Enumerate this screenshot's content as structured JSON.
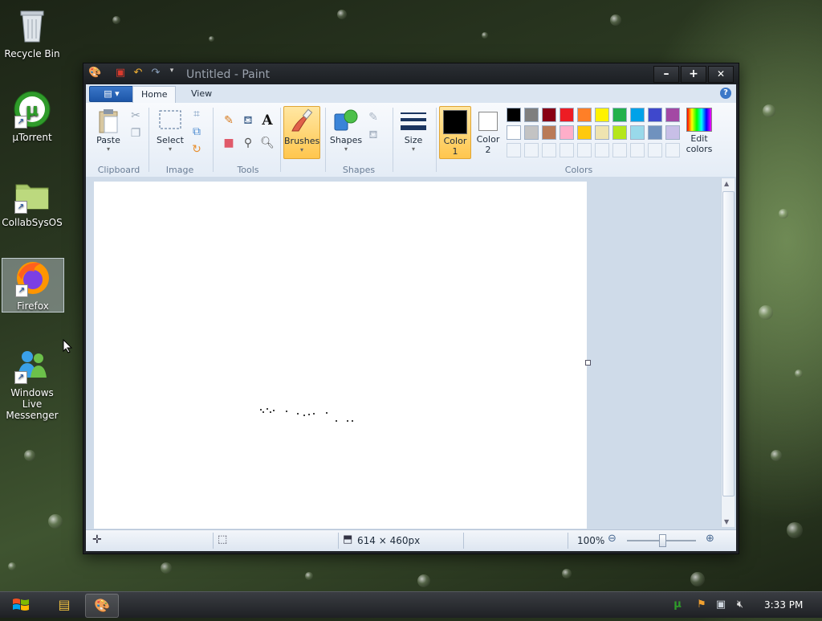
{
  "desktop": {
    "icons": [
      {
        "label": "Recycle Bin"
      },
      {
        "label": "µTorrent"
      },
      {
        "label": "CollabSysOS"
      },
      {
        "label": "Firefox"
      },
      {
        "label": "Windows Live Messenger"
      }
    ]
  },
  "window": {
    "title": "Untitled - Paint",
    "buttons": {
      "minimize": "–",
      "maximize": "+",
      "close": "✕"
    }
  },
  "tabs": {
    "home": "Home",
    "view": "View",
    "help": "?"
  },
  "ribbon": {
    "clipboard": {
      "paste": "Paste",
      "label": "Clipboard"
    },
    "image": {
      "select": "Select",
      "label": "Image"
    },
    "tools": {
      "label": "Tools"
    },
    "brushes": {
      "label": "Brushes"
    },
    "shapes": {
      "shapes": "Shapes",
      "label": "Shapes"
    },
    "size": {
      "label": "Size"
    },
    "colors": {
      "color1": "Color",
      "color1_num": "1",
      "color2": "Color",
      "color2_num": "2",
      "edit": "Edit",
      "edit2": "colors",
      "label": "Colors",
      "palette_row1": [
        "#000000",
        "#7f7f7f",
        "#880015",
        "#ed1c24",
        "#ff7f27",
        "#fff200",
        "#22b14c",
        "#00a2e8",
        "#3f48cc",
        "#a349a4"
      ],
      "palette_row2": [
        "#ffffff",
        "#c3c3c3",
        "#b97a57",
        "#ffaec9",
        "#ffc90e",
        "#efe4b0",
        "#b5e61d",
        "#99d9ea",
        "#7092be",
        "#c8bfe7"
      ]
    }
  },
  "status": {
    "canvas_size": "614 × 460px",
    "zoom": "100%"
  },
  "taskbar": {
    "clock": "3:33 PM"
  }
}
